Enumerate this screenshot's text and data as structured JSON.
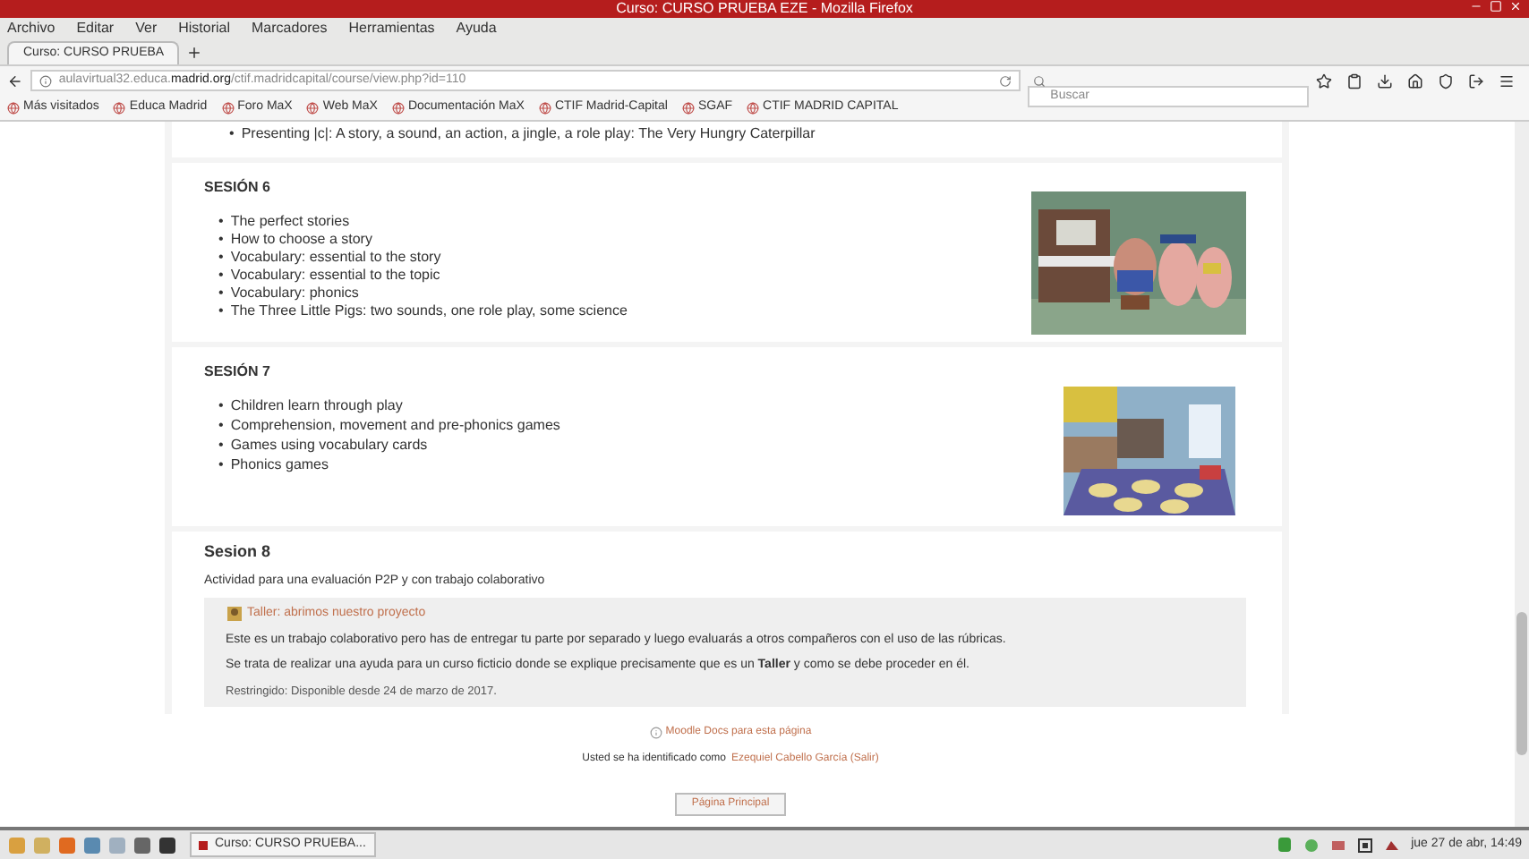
{
  "window": {
    "title": "Curso: CURSO PRUEBA EZE - Mozilla Firefox"
  },
  "menu": [
    "Archivo",
    "Editar",
    "Ver",
    "Historial",
    "Marcadores",
    "Herramientas",
    "Ayuda"
  ],
  "tab": {
    "title": "Curso: CURSO PRUEBA"
  },
  "address": {
    "host_pre": "aulavirtual32.educa.",
    "host": "madrid.org",
    "path": "/ctif.madridcapital/course/view.php?id=110"
  },
  "search": {
    "placeholder": "Buscar"
  },
  "bookmarks": [
    "Más visitados",
    "Educa Madrid",
    "Foro MaX",
    "Web MaX",
    "Documentación MaX",
    "CTIF Madrid-Capital",
    "SGAF",
    "CTIF MADRID CAPITAL"
  ],
  "bullet": "•",
  "top_item": "Presenting |c|: A story, a sound, an action, a jingle,  a role play: The Very Hungry Caterpillar",
  "sections": [
    {
      "title": "SESIÓN 6",
      "items": [
        "The perfect stories",
        "How to choose a story",
        "Vocabulary: essential to the story",
        "Vocabulary: essential to the topic",
        "Vocabulary: phonics",
        "The Three Little Pigs: two sounds, one role play, some science"
      ],
      "picture": {
        "kind": "cartoon"
      }
    },
    {
      "title": "SESIÓN 7",
      "items": [
        "Children learn through play",
        "Comprehension, movement and pre-phonics games",
        "Games using vocabulary cards",
        "Phonics games"
      ],
      "picture": {
        "kind": "classroom"
      }
    }
  ],
  "session8": {
    "title": "Sesion 8",
    "description": "Actividad para una evaluación P2P y con trabajo colaborativo",
    "activity": {
      "link": "Taller: abrimos nuestro proyecto",
      "paragraphs": [
        "Este es un trabajo colaborativo pero has de entregar tu parte por separado y luego evaluarás a otros compañeros con el uso de las rúbricas.",
        "Se trata de realizar una ayuda para un curso ficticio donde se explique precisamente que es un **Taller** y como se debe proceder en él."
      ],
      "restriction": "Restringido: Disponible desde 24 de marzo de 2017."
    }
  },
  "footer": {
    "docs_link": "Moodle Docs para esta página",
    "login_text": "Usted se ha identificado como",
    "user_link": "Ezequiel Cabello García (Salir)",
    "home_button": "Página Principal"
  },
  "taskbar": {
    "task": "Curso: CURSO PRUEBA...",
    "clock": "jue 27 de abr, 14:49"
  }
}
